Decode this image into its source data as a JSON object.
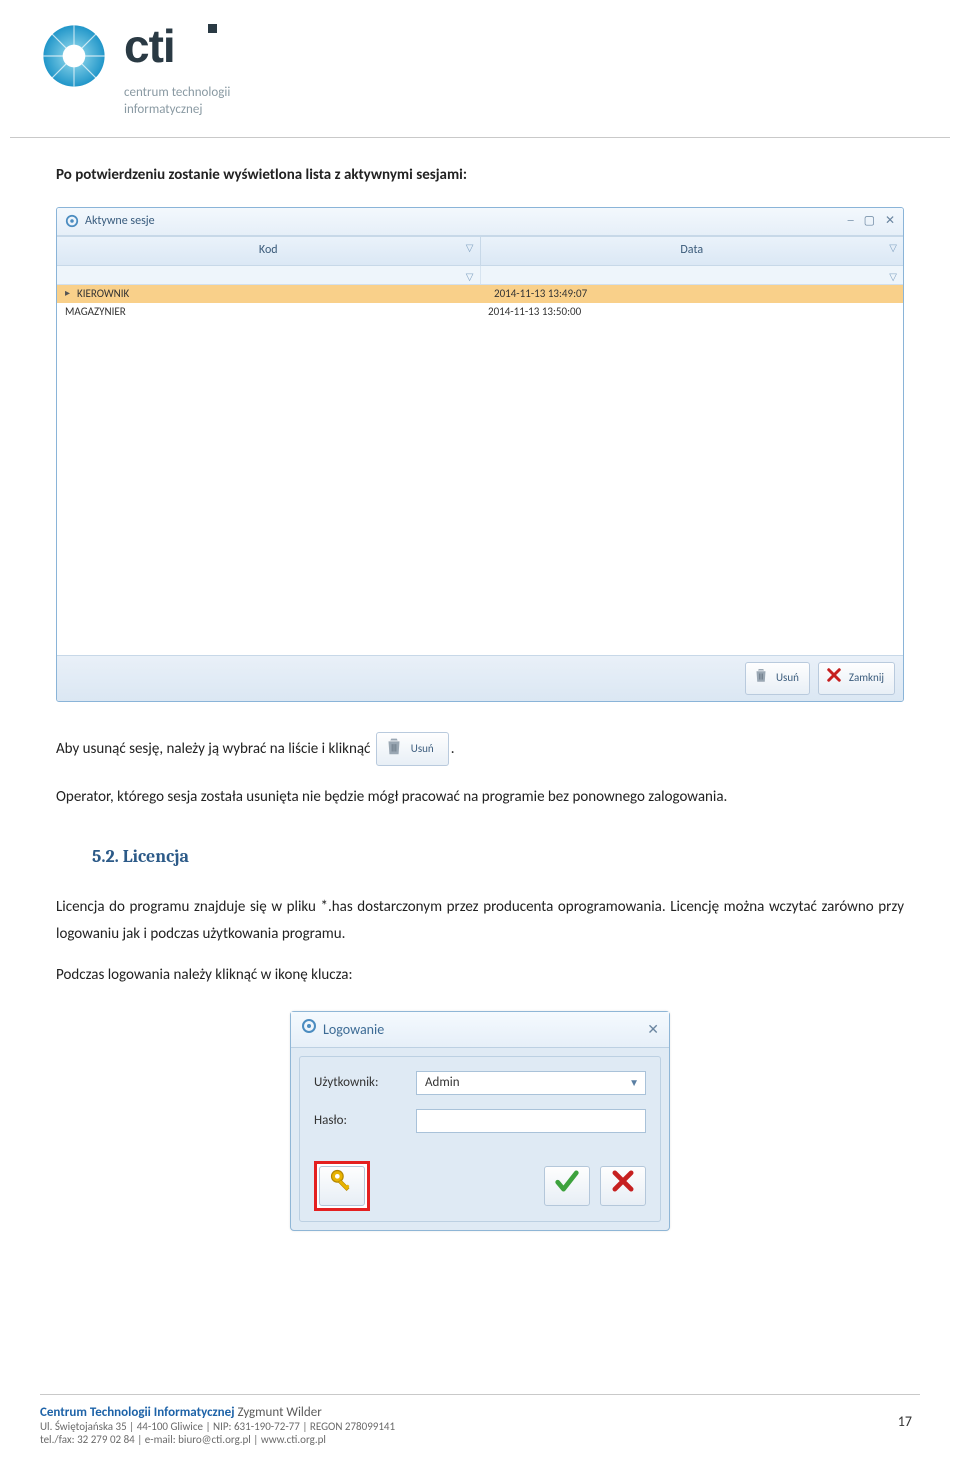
{
  "header": {
    "logo_sub_line1": "centrum technologii",
    "logo_sub_line2": "informatycznej"
  },
  "para1": "Po potwierdzeniu zostanie wyświetlona lista z aktywnymi sesjami:",
  "win1": {
    "title": "Aktywne sesje",
    "col_kod": "Kod",
    "col_data": "Data",
    "rows": [
      {
        "kod": "KIEROWNIK",
        "data": "2014-11-13 13:49:07"
      },
      {
        "kod": "MAGAZYNIER",
        "data": "2014-11-13 13:50:00"
      }
    ],
    "btn_usun": "Usuń",
    "btn_zamknij": "Zamknij"
  },
  "para2_pre": "Aby usunąć sesję, należy ją wybrać na liście i kliknąć ",
  "para2_btn": "Usuń",
  "para2_post": ".",
  "para3": "Operator, którego sesja została usunięta nie będzie mógł pracować na programie bez ponownego zalogowania.",
  "heading": "5.2.   Licencja",
  "para4": "Licencja do programu znajduje się w pliku *.has dostarczonym przez producenta oprogramowania. Licencję można wczytać zarówno przy logowaniu jak i podczas użytkowania programu.",
  "para5": "Podczas logowania należy kliknąć w ikonę klucza:",
  "login": {
    "title": "Logowanie",
    "user_label": "Użytkownik:",
    "user_value": "Admin",
    "pass_label": "Hasło:"
  },
  "footer": {
    "strong": "Centrum Technologii Informatycznej",
    "name": " Zygmunt Wilder",
    "line2": "Ul. Świętojańska 35  |  44-100 Gliwice  |  NIP: 631-190-72-77  |  REGON 278099141",
    "line3": "tel./fax: 32 279 02 84  |  e-mail: biuro@cti.org.pl  |  www.cti.org.pl",
    "page": "17"
  }
}
